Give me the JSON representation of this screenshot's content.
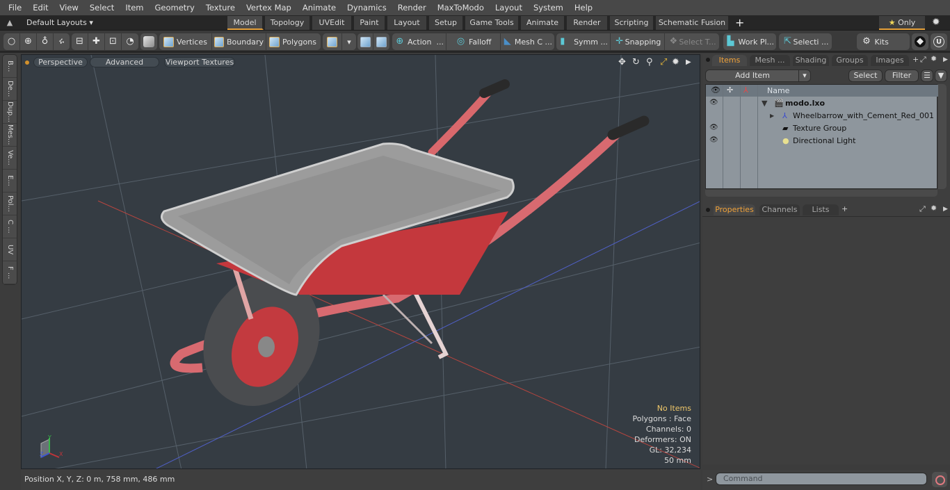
{
  "menu": [
    "File",
    "Edit",
    "View",
    "Select",
    "Item",
    "Geometry",
    "Texture",
    "Vertex Map",
    "Animate",
    "Dynamics",
    "Render",
    "MaxToModo",
    "Layout",
    "System",
    "Help"
  ],
  "layout_bar": {
    "layouts_label": "Default Layouts",
    "tabs": [
      "Model",
      "Topology",
      "UVEdit",
      "Paint",
      "Layout",
      "Setup",
      "Game Tools",
      "Animate",
      "Render",
      "Scripting",
      "Schematic Fusion"
    ],
    "active_tab": "Model",
    "add_label": "+",
    "only_label": "Only",
    "star": "★"
  },
  "toolbar": {
    "vertices": "Vertices",
    "boundary": "Boundary",
    "polygons": "Polygons",
    "action": "Action",
    "falloff": "Falloff",
    "mesh_c": "Mesh C ...",
    "symm": "Symm ...",
    "snapping": "Snapping",
    "select_t": "Select T...",
    "work_pl": "Work Pl...",
    "selecti": "Selecti ...",
    "kits": "Kits",
    "ellipsis": "..."
  },
  "left_tabs": [
    "B...",
    "De...",
    "Dup...",
    "Mes...",
    "Ve...",
    "E...",
    "Pol...",
    "C ...",
    "UV",
    "F ..."
  ],
  "viewport": {
    "perspective": "Perspective",
    "advanced": "Advanced",
    "viewport_textures": "Viewport Textures",
    "stats": {
      "items": "No Items",
      "polygons": "Polygons : Face",
      "channels": "Channels: 0",
      "deformers": "Deformers: ON",
      "gl": "GL: 32,234",
      "scale": "50 mm"
    },
    "axis": {
      "x": "X",
      "y": "Y",
      "z": "Z"
    }
  },
  "status": {
    "position": "Position X, Y, Z:   0 m, 758 mm, 486 mm"
  },
  "items_panel": {
    "tabs": [
      "Items",
      "Mesh ...",
      "Shading",
      "Groups",
      "Images"
    ],
    "active_tab": "Items",
    "add_item": "Add Item",
    "select": "Select",
    "filter": "Filter",
    "name_header": "Name",
    "tree": [
      {
        "label": "modo.lxo",
        "visible": true,
        "bold": true,
        "expanded": true
      },
      {
        "label": "Wheelbarrow_with_Cement_Red_001",
        "visible": false,
        "bold": false,
        "expanded": false
      },
      {
        "label": "Texture Group",
        "visible": true,
        "bold": false
      },
      {
        "label": "Directional Light",
        "visible": true,
        "bold": false
      }
    ]
  },
  "properties_panel": {
    "tabs": [
      "Properties",
      "Channels",
      "Lists"
    ],
    "active_tab": "Properties",
    "add": "+"
  },
  "command": {
    "prompt": ">",
    "placeholder": "Command"
  },
  "colors": {
    "accent": "#e8a23a",
    "viewport_bg": "#353c43",
    "tree_bg": "#8e969d",
    "red_paint": "#c9383e"
  }
}
